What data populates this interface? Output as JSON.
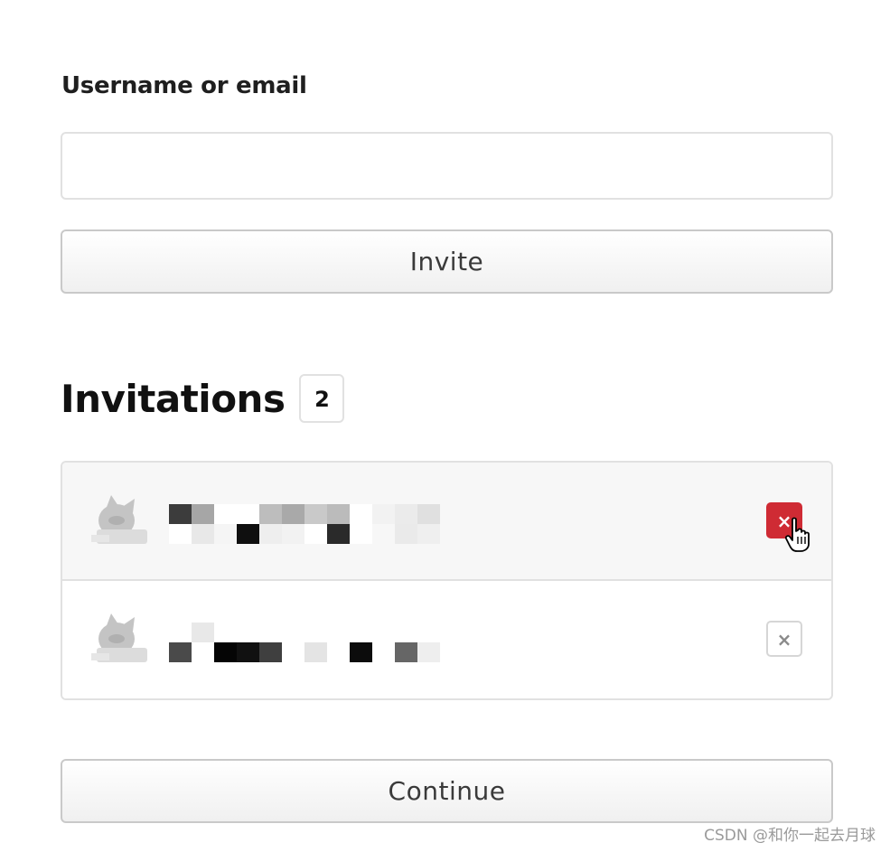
{
  "form": {
    "username_label": "Username or email",
    "username_value": "",
    "invite_label": "Invite"
  },
  "invitations": {
    "title": "Invitations",
    "count": "2",
    "items": [
      {
        "username": "",
        "remove_icon": "×",
        "state": "hover"
      },
      {
        "username": "",
        "remove_icon": "×",
        "state": "normal"
      }
    ]
  },
  "footer": {
    "continue_label": "Continue"
  },
  "watermark": "CSDN @和你一起去月球",
  "colors": {
    "remove_active": "#cf2b34",
    "border": "#e1e1e1"
  }
}
